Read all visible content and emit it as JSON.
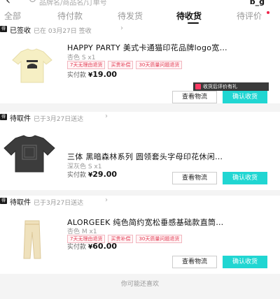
{
  "header": {
    "back_glyph": "‹",
    "search_placeholder": "品牌名/商品名/订单号",
    "corner_tag": "b_g"
  },
  "tabs": [
    {
      "label": "全部",
      "active": false
    },
    {
      "label": "待付款",
      "active": false
    },
    {
      "label": "待发货",
      "active": false
    },
    {
      "label": "待收货",
      "active": true
    },
    {
      "label": "待评价",
      "active": false
    }
  ],
  "orders": [
    {
      "store_icon": "得物",
      "status": "已签收",
      "status_note": "已在 03月27日 签收",
      "title": "HAPPY PARTY 美式卡通猫印花品牌logo宽…",
      "spec": "杏色 S x1",
      "tags": [
        "7天无理由退货",
        "买贵补偿",
        "30天质量问题退货"
      ],
      "paid_label": "实付款",
      "currency": "¥",
      "amount": "19.00",
      "btn_logistics": "查看物流",
      "btn_confirm": "确认收货",
      "review_tip": "收货后评价有礼"
    },
    {
      "store_icon": "得物",
      "status": "待取件",
      "status_note": "已于3月27日送达",
      "title": "三体 黑暗森林系列 圆领套头字母印花休闲…",
      "spec": "深灰色 S x1",
      "tags": [],
      "paid_label": "实付款",
      "currency": "¥",
      "amount": "29.00",
      "btn_logistics": "查看物流",
      "btn_confirm": "确认收货"
    },
    {
      "store_icon": "得物",
      "status": "待取件",
      "status_note": "已于3月27日送达",
      "title": "ALORGEEK 纯色简约宽松垂感基础款直筒…",
      "spec": "杏色 M x1",
      "tags": [
        "7天无理由退货",
        "买贵补偿",
        "30天质量问题退货"
      ],
      "paid_label": "实付款",
      "currency": "¥",
      "amount": "60.00",
      "btn_logistics": "查看物流",
      "btn_confirm": "确认收货"
    }
  ],
  "footer": {
    "maybe_like": "你可能还喜欢"
  },
  "colors": {
    "accent_cyan": "#20d6d2",
    "tag_red": "#e33a52",
    "dot_red": "#f0234a"
  }
}
